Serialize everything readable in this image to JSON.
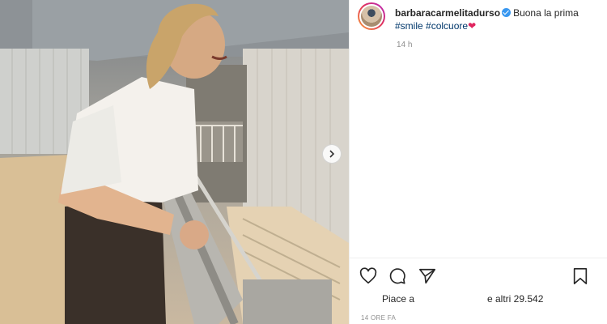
{
  "post": {
    "username": "barbaracarmelitadurso",
    "caption_text": "Buona la prima ",
    "hashtags": [
      "#smile",
      "#colcuore"
    ],
    "emoji": "❤",
    "relative_time": "14 h",
    "likes_prefix": "Piace a",
    "likes_suffix": "e altri 29.542",
    "timestamp": "14 ORE FA"
  },
  "icons": {
    "verified": "verified-badge-icon",
    "like": "heart-outline-icon",
    "comment": "comment-icon",
    "share": "paper-plane-icon",
    "save": "bookmark-icon",
    "next": "chevron-right-icon"
  },
  "colors": {
    "verified": "#3897f0",
    "hashtag": "#00376b",
    "muted": "#8e8e8e",
    "heart": "#e0245e"
  }
}
